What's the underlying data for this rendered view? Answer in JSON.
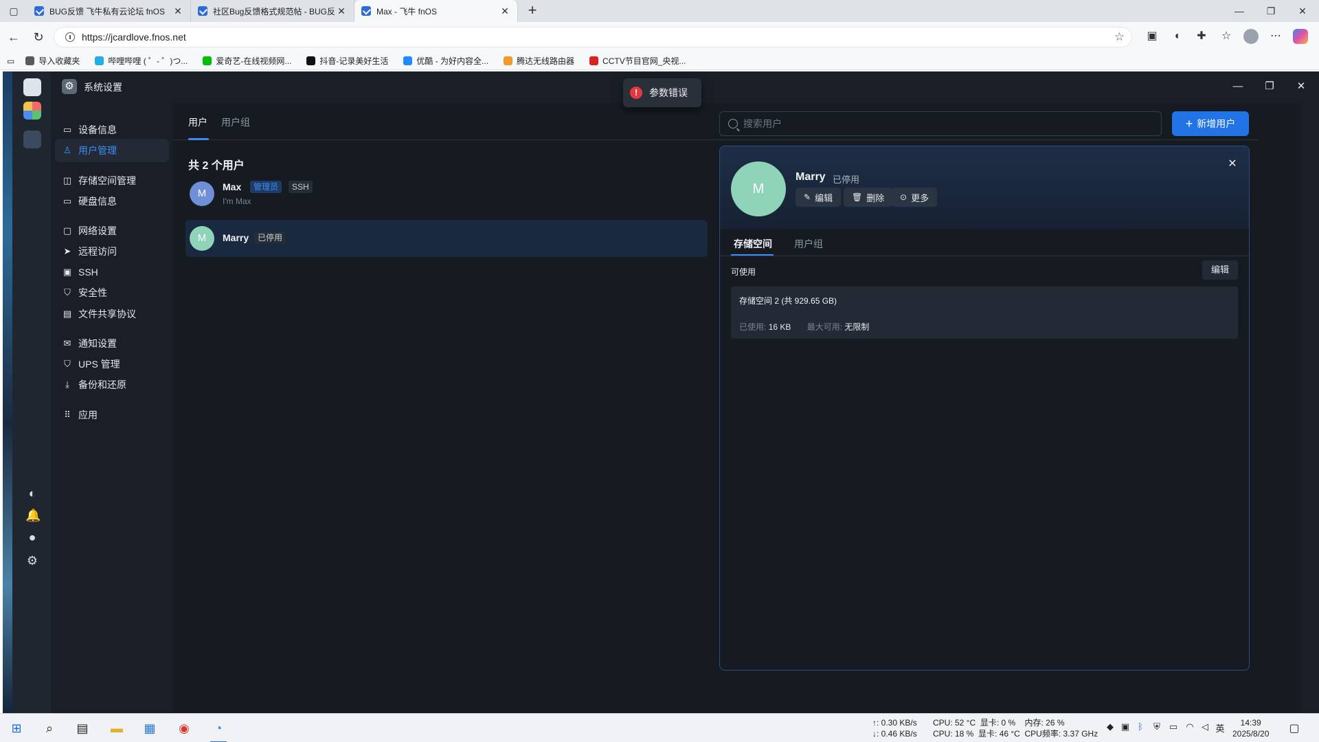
{
  "browser": {
    "tabs": [
      {
        "label": "BUG反馈 飞牛私有云论坛 fnOS"
      },
      {
        "label": "社区Bug反馈格式规范帖 - BUG反"
      },
      {
        "label": "Max - 飞牛 fnOS"
      }
    ],
    "new_tab": "+",
    "url": "https://jcardlove.fnos.net",
    "bookmarks": [
      {
        "label": "导入收藏夹",
        "color": "#5a5a5a"
      },
      {
        "label": "哔哩哔哩 ( ゜- ゜)つ...",
        "color": "#23ade5"
      },
      {
        "label": "爱奇艺-在线视频网...",
        "color": "#00be06"
      },
      {
        "label": "抖音-记录美好生活",
        "color": "#111111"
      },
      {
        "label": "优酷 - 为好内容全...",
        "color": "#1f8bff"
      },
      {
        "label": "腾达无线路由器",
        "color": "#f29a2e"
      },
      {
        "label": "CCTV节目官网_央视...",
        "color": "#d7261e"
      }
    ]
  },
  "app": {
    "title": "系统设置",
    "toast": "参数错误",
    "nav": [
      {
        "label": "设备信息",
        "icon": "device-icon"
      },
      {
        "label": "用户管理",
        "icon": "user-icon",
        "active": true
      },
      {
        "label": "存储空间管理",
        "icon": "storage-icon"
      },
      {
        "label": "硬盘信息",
        "icon": "disk-icon"
      },
      {
        "label": "网络设置",
        "icon": "network-icon"
      },
      {
        "label": "远程访问",
        "icon": "remote-icon"
      },
      {
        "label": "SSH",
        "icon": "ssh-icon"
      },
      {
        "label": "安全性",
        "icon": "shield-icon"
      },
      {
        "label": "文件共享协议",
        "icon": "file-share-icon"
      },
      {
        "label": "通知设置",
        "icon": "mail-icon"
      },
      {
        "label": "UPS 管理",
        "icon": "ups-icon"
      },
      {
        "label": "备份和还原",
        "icon": "backup-icon"
      },
      {
        "label": "应用",
        "icon": "apps-icon"
      }
    ],
    "tabs": [
      "用户",
      "用户组"
    ],
    "user_count": "共 2 个用户",
    "search_placeholder": "搜索用户",
    "add_user": "新增用户",
    "users": [
      {
        "initial": "M",
        "name": "Max",
        "badges": [
          "管理员",
          "SSH"
        ],
        "subtitle": "I'm Max",
        "avatar_color": "#6f8fd6"
      },
      {
        "initial": "M",
        "name": "Marry",
        "badges": [
          "已停用"
        ],
        "subtitle": "",
        "avatar_color": "#8fd4b8",
        "selected": true
      }
    ],
    "detail": {
      "initial": "M",
      "name": "Marry",
      "status": "已停用",
      "buttons": [
        "编辑",
        "删除",
        "更多"
      ],
      "tabs": [
        "存储空间",
        "用户组"
      ],
      "available_label": "可使用",
      "edit": "编辑",
      "storage": {
        "name": "存储空间 2 (共 929.65 GB)",
        "used_label": "已使用:",
        "used_value": "16 KB",
        "max_label": "最大可用:",
        "max_value": "无限制"
      }
    }
  },
  "taskbar": {
    "net_up": "↑: 0.30 KB/s",
    "net_down": "↓: 0.46 KB/s",
    "line1": "CPU: 52 °C  显卡: 0 %    内存: 26 %",
    "line2": "CPU: 18 %  显卡: 46 °C  CPU频率: 3.37 GHz",
    "ime": "英",
    "time": "14:39",
    "date": "2025/8/20"
  }
}
